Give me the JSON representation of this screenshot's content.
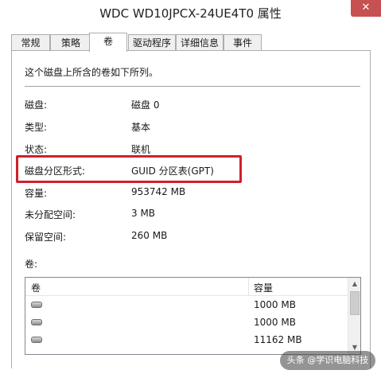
{
  "window": {
    "title": "WDC WD10JPCX-24UE4T0 属性",
    "close_glyph": "✕"
  },
  "tabs": [
    {
      "label": "常规"
    },
    {
      "label": "策略"
    },
    {
      "label": "卷",
      "active": true
    },
    {
      "label": "驱动程序"
    },
    {
      "label": "详细信息"
    },
    {
      "label": "事件"
    }
  ],
  "description": "这个磁盘上所含的卷如下所列。",
  "properties": [
    {
      "label": "磁盘:",
      "value": "磁盘 0"
    },
    {
      "label": "类型:",
      "value": "基本"
    },
    {
      "label": "状态:",
      "value": "联机"
    },
    {
      "label": "磁盘分区形式:",
      "value": "GUID 分区表(GPT)",
      "highlighted": true
    },
    {
      "label": "容量:",
      "value": "953742 MB"
    },
    {
      "label": "未分配空间:",
      "value": "3 MB"
    },
    {
      "label": "保留空间:",
      "value": "260 MB"
    }
  ],
  "volumes": {
    "label": "卷:",
    "columns": [
      "卷",
      "容量"
    ],
    "rows": [
      {
        "icon": "disk-icon",
        "size": "1000 MB"
      },
      {
        "icon": "disk-icon",
        "size": "1000 MB"
      },
      {
        "icon": "disk-icon",
        "size": "11162 MB"
      }
    ]
  },
  "watermark": "头条 @学识电脑科技",
  "colors": {
    "highlight": "#d0202a",
    "close_button": "#c75050"
  }
}
